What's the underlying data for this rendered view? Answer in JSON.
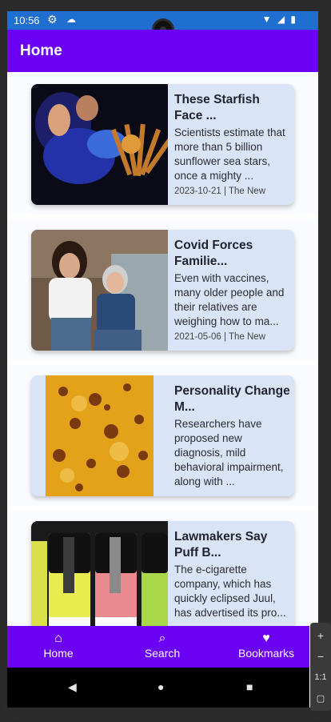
{
  "status_bar": {
    "time": "10:56",
    "icons": [
      "gear-icon",
      "cloud-icon",
      "wifi-icon",
      "signal-icon",
      "battery-icon"
    ]
  },
  "app_bar": {
    "title": "Home"
  },
  "articles": [
    {
      "title": "These Starfish Face ...",
      "snippet": "Scientists estimate that more than 5 billion sunflower sea stars, once a mighty ...",
      "meta": "2023-10-21 | The New"
    },
    {
      "title": "Covid Forces Familie...",
      "snippet": "Even with vaccines, many older people and their relatives are weighing how to ma...",
      "meta": "2021-05-06 | The New"
    },
    {
      "title": "Personality Change M...",
      "snippet": "Researchers have proposed new diagnosis, mild behavioral impairment, along with ...",
      "meta": ""
    },
    {
      "title": "Lawmakers Say Puff B...",
      "snippet": "The e-cigarette company, which has quickly eclipsed Juul, has advertised its pro...",
      "meta": ""
    }
  ],
  "bottom_nav": [
    {
      "label": "Home",
      "icon": "home-icon"
    },
    {
      "label": "Search",
      "icon": "search-icon"
    },
    {
      "label": "Bookmarks",
      "icon": "heart-icon"
    }
  ],
  "side_tools": {
    "zoom_label": "1:1"
  },
  "colors": {
    "primary": "#6a00f4",
    "card": "#d9e4f7",
    "status": "#1f6fd1"
  }
}
